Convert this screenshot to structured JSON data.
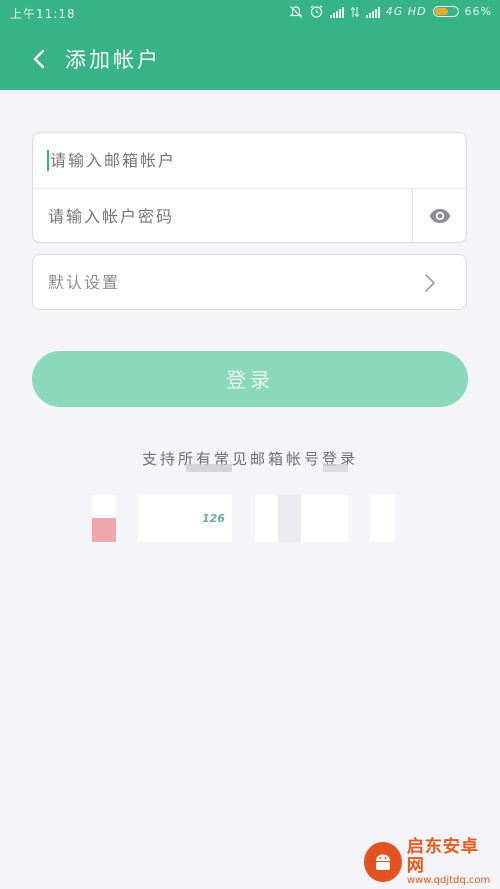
{
  "status_bar": {
    "time": "上午11:18",
    "network": "4G HD",
    "battery": "66%",
    "battery_level": 0.66,
    "battery_color": "#f5a623"
  },
  "app_bar": {
    "title": "添加帐户",
    "back_icon": "chevron-left-icon",
    "color": "#36b387"
  },
  "form": {
    "email_placeholder": "请输入邮箱帐户",
    "password_placeholder": "请输入帐户密码",
    "visibility_icon": "eye-icon",
    "settings_label": "默认设置",
    "settings_icon": "chevron-right-icon"
  },
  "login_button": {
    "label": "登录",
    "color": "#8bd8bd"
  },
  "support_text": "支持所有常见邮箱帐号登录",
  "providers": {
    "partial_label": "126"
  },
  "watermark": {
    "name": "启东安卓网",
    "url": "www.qdjtdq.com"
  }
}
